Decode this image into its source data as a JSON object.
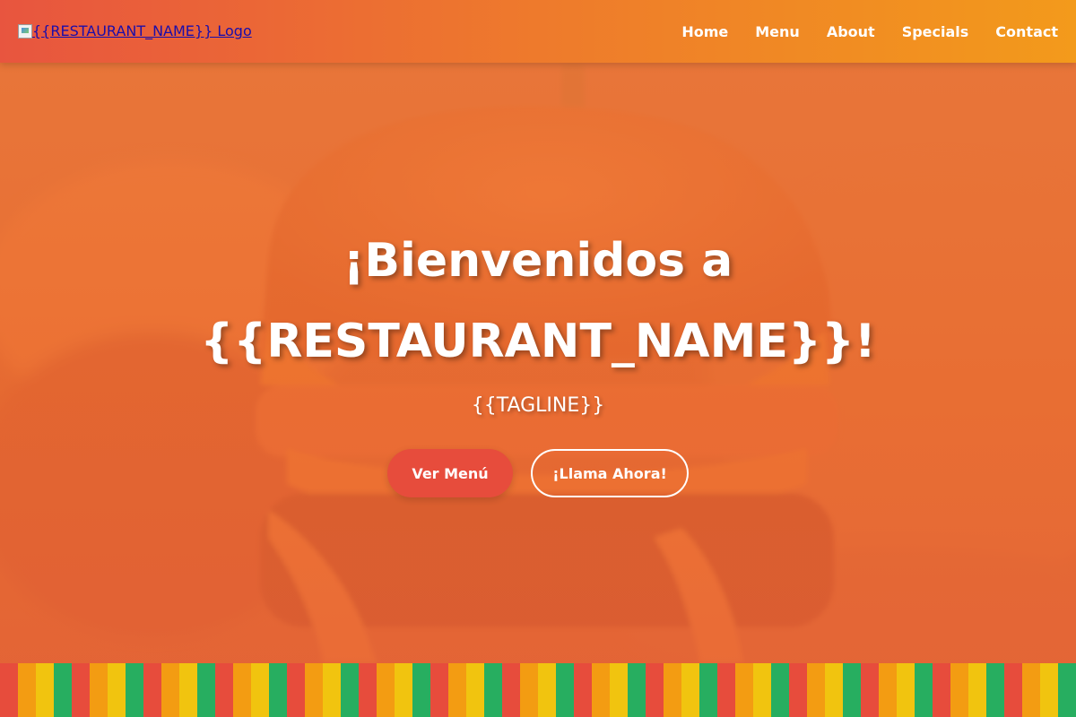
{
  "navbar": {
    "logo_alt": "{{RESTAURANT_NAME}} Logo",
    "links": [
      {
        "label": "Home"
      },
      {
        "label": "Menu"
      },
      {
        "label": "About"
      },
      {
        "label": "Specials"
      },
      {
        "label": "Contact"
      }
    ]
  },
  "hero": {
    "title_line1": "¡Bienvenidos a",
    "title_line2": "{{RESTAURANT_NAME}}!",
    "tagline": "{{TAGLINE}}",
    "primary_button": "Ver Menú",
    "secondary_button": "¡Llama Ahora!"
  },
  "colors": {
    "nav_gradient_start": "#e8553f",
    "nav_gradient_end": "#f39a1b",
    "primary_button": "#e74c3c",
    "overlay": "#ee7034",
    "stripe_pattern": [
      "#e74c3c",
      "#f39c12",
      "#f1c40f",
      "#27ae60"
    ]
  }
}
